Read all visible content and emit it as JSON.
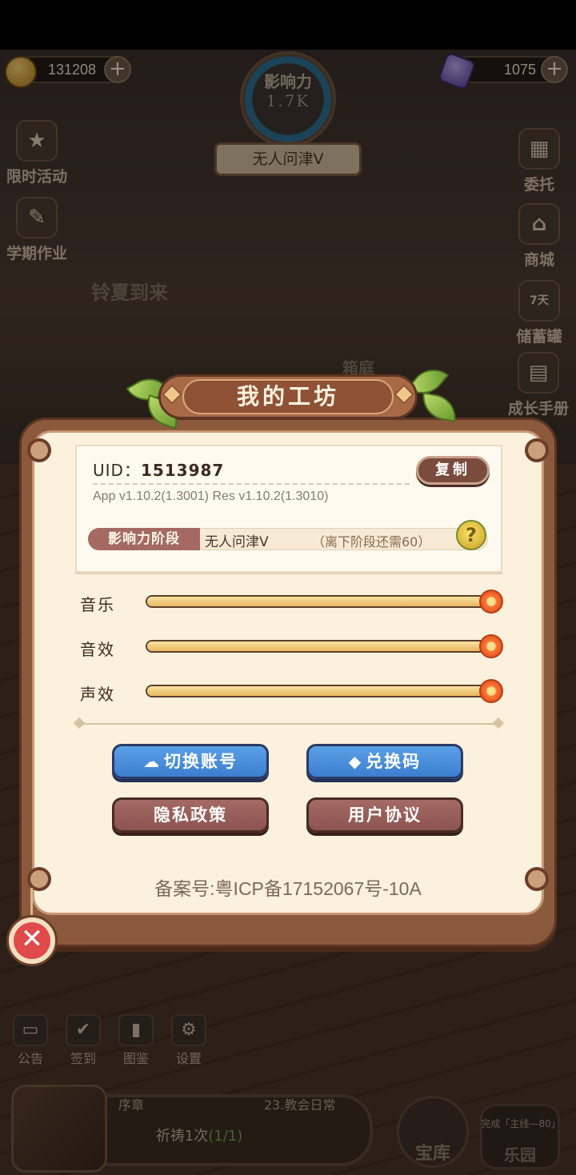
{
  "hud": {
    "coins": "131208",
    "gems": "1075",
    "influence_label": "影响力",
    "influence_value": "1.7K",
    "rank": "无人问津V"
  },
  "left_menu": [
    {
      "label": "限时活动",
      "icon": "calendar-event-icon"
    },
    {
      "label": "学期作业",
      "icon": "homework-scroll-icon"
    }
  ],
  "right_menu": [
    {
      "label": "委托",
      "icon": "commission-icon"
    },
    {
      "label": "商城",
      "icon": "shop-icon"
    },
    {
      "label": "储蓄罐",
      "badge": "7天",
      "icon": "piggy-bank-icon"
    },
    {
      "label": "成长手册",
      "icon": "growth-book-icon"
    }
  ],
  "scene": {
    "sign_left": "铃夏到来",
    "sign_center": "箱庭"
  },
  "bottom_bar": {
    "icons": [
      {
        "label": "公告",
        "icon": "notice-icon",
        "glyph": "▭"
      },
      {
        "label": "签到",
        "icon": "checkin-icon",
        "glyph": "✔"
      },
      {
        "label": "图鉴",
        "icon": "collection-book-icon",
        "glyph": "▮"
      },
      {
        "label": "设置",
        "icon": "gear-icon",
        "glyph": "⚙"
      }
    ],
    "quest": {
      "chapter": "序章",
      "stage": "23.教会日常",
      "task_text": "祈祷1次",
      "task_progress": "(1/1)"
    },
    "chest_label": "宝库",
    "ring_note": "完成「主线—80」",
    "ring_label": "乐园"
  },
  "panel": {
    "title": "我的工坊",
    "uid_label": "UID：",
    "uid_value": "1513987",
    "copy_label": "复制",
    "version_text": "App v1.10.2(1.3001)   Res v1.10.2(1.3010)",
    "stage_label": "影响力阶段",
    "stage_value": "无人问津V",
    "stage_hint": "（离下阶段还需60）",
    "help_glyph": "?",
    "sliders": [
      {
        "label": "音乐",
        "value": 1.0
      },
      {
        "label": "音效",
        "value": 1.0
      },
      {
        "label": "声效",
        "value": 1.0
      }
    ],
    "buttons": {
      "switch_account": "切换账号",
      "redeem_code": "兑换码",
      "privacy_policy": "隐私政策",
      "user_agreement": "用户协议"
    },
    "icp": "备案号:粤ICP备17152067号-10A"
  },
  "close_glyph": "✕"
}
